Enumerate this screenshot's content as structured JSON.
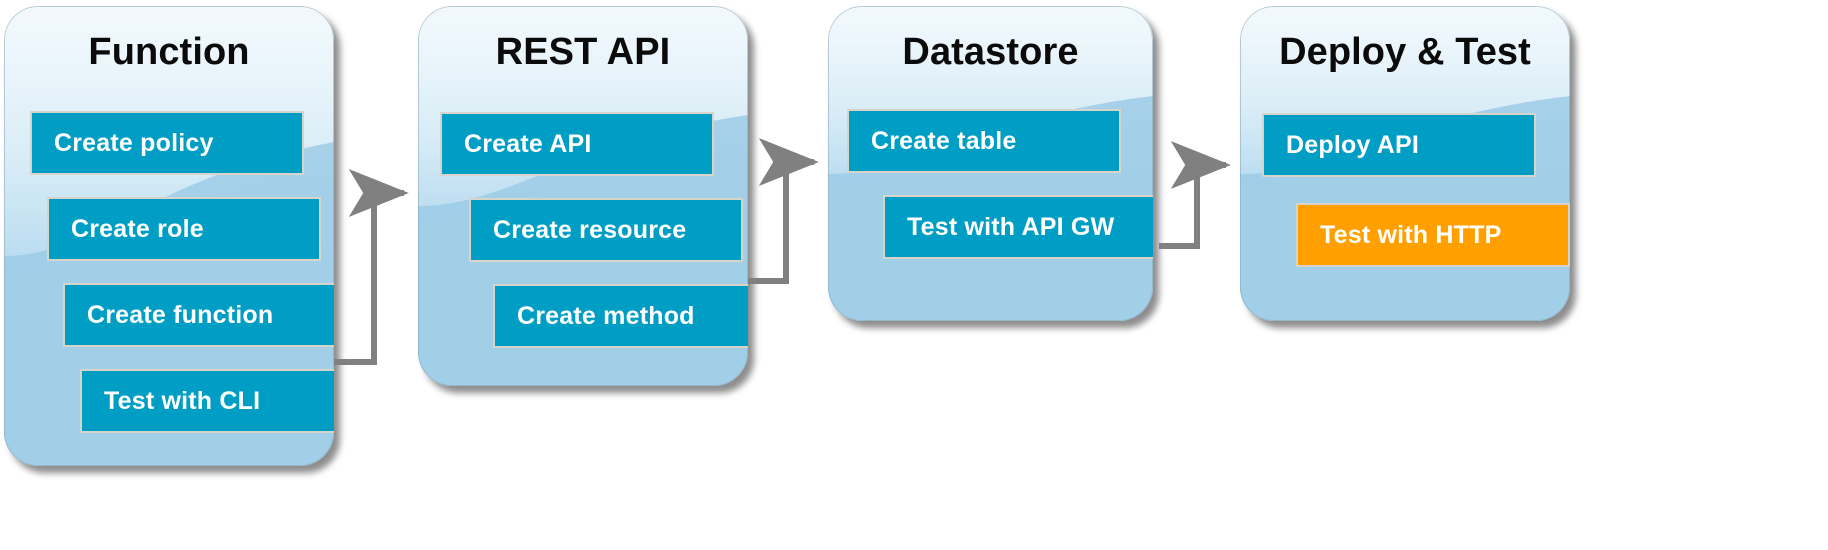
{
  "diagram": {
    "title_semantic": "serverless-api-build-workflow",
    "colors": {
      "chip_blue": "#009ec4",
      "chip_highlight_orange": "#ffa000",
      "chip_border": "#d9d4cb",
      "panel_top": "#f2f9fd",
      "panel_bottom": "#9ecce7",
      "connector_gray": "#808080",
      "title_text": "#0b0b0b",
      "chip_text": "#ffffff",
      "background": "#ffffff"
    },
    "panels": [
      {
        "id": "function",
        "title": "Function",
        "steps": [
          {
            "label": "Create policy",
            "highlight": false
          },
          {
            "label": "Create role",
            "highlight": false
          },
          {
            "label": "Create function",
            "highlight": false
          },
          {
            "label": "Test with CLI",
            "highlight": false
          }
        ]
      },
      {
        "id": "rest-api",
        "title": "REST API",
        "steps": [
          {
            "label": "Create API",
            "highlight": false
          },
          {
            "label": "Create resource",
            "highlight": false
          },
          {
            "label": "Create method",
            "highlight": false
          }
        ]
      },
      {
        "id": "datastore",
        "title": "Datastore",
        "steps": [
          {
            "label": "Create table",
            "highlight": false
          },
          {
            "label": "Test with API GW",
            "highlight": false
          }
        ]
      },
      {
        "id": "deploy-and-test",
        "title": "Deploy & Test",
        "steps": [
          {
            "label": "Deploy API",
            "highlight": false
          },
          {
            "label": "Test with HTTP",
            "highlight": true
          }
        ]
      }
    ],
    "connectors": [
      {
        "id": "function-to-rest-api",
        "from": "function",
        "to": "rest-api",
        "style": "elbow-arrow"
      },
      {
        "id": "rest-api-to-datastore",
        "from": "rest-api",
        "to": "datastore",
        "style": "elbow-arrow"
      },
      {
        "id": "datastore-to-deploy",
        "from": "datastore",
        "to": "deploy-and-test",
        "style": "elbow-arrow"
      }
    ]
  }
}
